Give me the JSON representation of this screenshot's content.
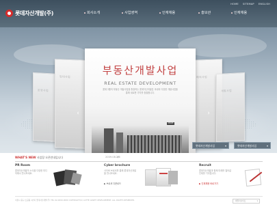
{
  "header": {
    "logo_text": "롯데자산개발(주)",
    "utility": [
      "HOME",
      "SITEMAP",
      "ENGLISH"
    ],
    "gnb": [
      "회사소개",
      "사업영역",
      "인재채용",
      "홍보관",
      "인재채용"
    ]
  },
  "hero": {
    "title": "부동산개발사업",
    "subtitle": "REAL ESTATE DEVELOPMENT",
    "description": "롯데그룹의 부동산 개발사업을 총괄하는 롯데자산개발은 국내외 다양한 개발사업을 통해 새로운 가치를 창출합니다.",
    "more_label": "MORE",
    "side_cards": [
      "운영사업",
      "임대사업",
      "해외사업",
      "개발사업"
    ],
    "selects": [
      "롯데자산개발사업",
      "롯데자산개발사업"
    ],
    "arrow_left": "‹",
    "arrow_right": "›"
  },
  "news": {
    "label": "WHAT'S NEW",
    "text": "사업장 오픈안내입니다",
    "date": "2009.08.28",
    "pager": "1/5"
  },
  "columns": {
    "pr": {
      "title": "PR Room",
      "desc": "롯데자산개발의 소식을 다양한 미디어에서 만나보세요.",
      "link": ""
    },
    "cyber": {
      "title": "Cyber brochure",
      "desc": "사이버 브로셔를 통해 롯데자산개발을 만나보세요.",
      "link": "▶ 브로셔 다운로드"
    },
    "recruit": {
      "title": "Recruit",
      "desc": "롯데자산개발과 함께 미래를 열어갈 인재를 기다립니다.",
      "link": "▶ 인재채용 바로가기"
    }
  },
  "footer": {
    "text": "서울시 중구 소공동 1번지 롯데자산개발(주) TEL 02-0000-0000 COPYRIGHT(C) LOTTE ASSET DEVELOPMENT. ALL RIGHTS RESERVED.",
    "family_label": "패밀리사이트"
  },
  "colors": {
    "header_bg": "#4a5c6a",
    "accent_red": "#c24141",
    "select_bg": "#60707d"
  }
}
